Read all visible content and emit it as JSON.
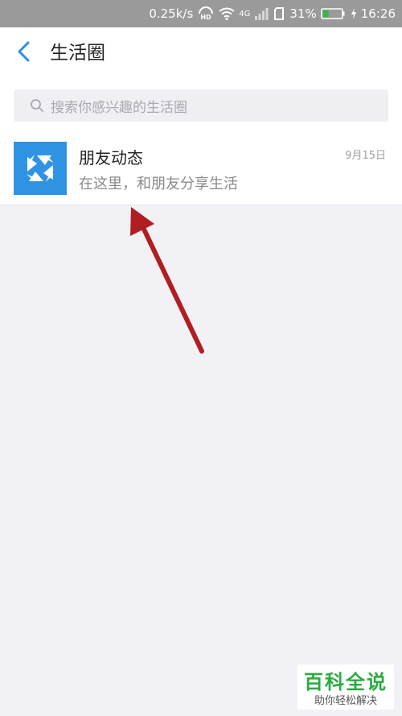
{
  "status_bar": {
    "network_speed": "0.25k/s",
    "hd_label": "HD",
    "network_type": "4G",
    "battery_percent": "31%",
    "battery_level": 0.31,
    "time": "16:26"
  },
  "nav": {
    "title": "生活圈",
    "back_icon": "chevron-left-icon"
  },
  "search": {
    "placeholder": "搜索你感兴趣的生活圈",
    "icon": "search-icon"
  },
  "items": [
    {
      "title": "朋友动态",
      "subtitle": "在这里，和朋友分享生活",
      "date": "9月15日",
      "icon": "aperture-icon"
    }
  ],
  "watermark": {
    "title": "百科全说",
    "subtitle": "助你轻松解决"
  },
  "colors": {
    "accent": "#2f93e3",
    "annotation_arrow": "#b01e22",
    "watermark_green": "#2aab3f"
  }
}
